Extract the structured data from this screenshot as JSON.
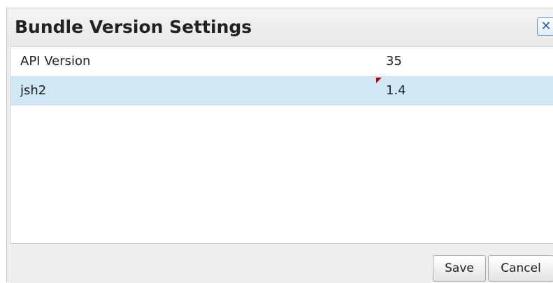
{
  "dialog": {
    "title": "Bundle Version Settings",
    "close_icon": "close-icon"
  },
  "rows": [
    {
      "name": "API Version",
      "value": "35",
      "modified": false
    },
    {
      "name": "jsh2",
      "value": "1.4",
      "modified": true
    }
  ],
  "footer": {
    "save_label": "Save",
    "cancel_label": "Cancel"
  },
  "colors": {
    "selected_row": "#cfe8f3",
    "dirty_marker": "#b00000",
    "close_accent": "#2a5aa8"
  }
}
